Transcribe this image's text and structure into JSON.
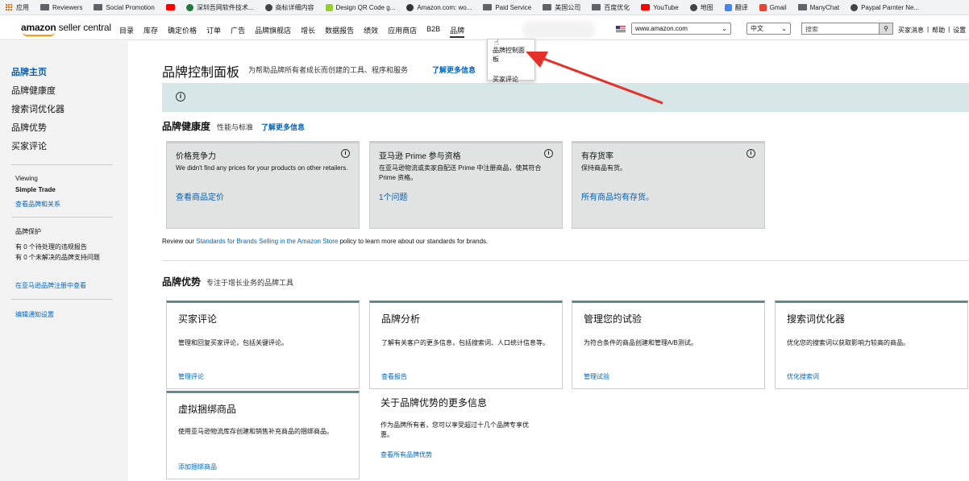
{
  "bookmarks": [
    "应用",
    "Reviewers",
    "Social Promotion",
    "",
    "深圳吾网软件技术...",
    "商标详细内容",
    "Design QR Code g...",
    "Amazon.com: wo...",
    "Paid Service",
    "美国公司",
    "百度优化",
    "YouTube",
    "地图",
    "翻译",
    "Gmail",
    "ManyChat",
    "Paypal Parnter Ne..."
  ],
  "nav": {
    "logo_main": "amazon",
    "logo_sub": " seller central",
    "menu": [
      "目录",
      "库存",
      "确定价格",
      "订单",
      "广告",
      "品牌旗舰店",
      "增长",
      "数据报告",
      "绩效",
      "应用商店",
      "B2B",
      "品牌"
    ],
    "marketplace": "www.amazon.com",
    "language": "中文",
    "search_placeholder": "搜索",
    "links": [
      "买家消息",
      "帮助",
      "设置"
    ]
  },
  "dropdown": [
    "品牌控制面板",
    "买家评论"
  ],
  "sidebar": {
    "nav": [
      "品牌主页",
      "品牌健康度",
      "搜索词优化器",
      "品牌优势",
      "买家评论"
    ],
    "viewing_label": "Viewing",
    "viewing_brand": "Simple Trade",
    "viewing_link": "查看品牌和关系",
    "protection_title": "品牌保护",
    "protection_line1": "有 0 个待处理的违规报告",
    "protection_line2": "有 0 个未解决的品牌支持问题",
    "protection_link": "在亚马逊品牌注册中查看",
    "notify_link": "编辑通知设置"
  },
  "main": {
    "title": "品牌控制面板",
    "subtitle": "为帮助品牌所有者成长而创建的工具、程序和服务",
    "learn_more": "了解更多信息",
    "health": {
      "title": "品牌健康度",
      "subtitle": "性能与标准",
      "learn_more": "了解更多信息",
      "cards": [
        {
          "title": "价格竞争力",
          "desc": "We didn't find any prices for your products on other retailers.",
          "value": "查看商品定价"
        },
        {
          "title": "亚马逊 Prime 参与资格",
          "desc": "在亚马逊物流或卖家自配送 Prime 中注册商品，使其符合 Prime 资格。",
          "value": "1个问题"
        },
        {
          "title": "有存货率",
          "desc": "保持商品有货。",
          "value": "所有商品均有存货。"
        }
      ]
    },
    "review_prefix": "Review our ",
    "review_link": "Standards for Brands Selling in the Amazon Store",
    "review_suffix": " policy to learn more about our standards for brands.",
    "benefits": {
      "title": "品牌优势",
      "subtitle": "专注于增长业务的品牌工具",
      "cards": [
        {
          "title": "买家评论",
          "desc": "管理和回复买家评论，包括关键评论。",
          "link": "管理评论"
        },
        {
          "title": "品牌分析",
          "desc": "了解有关客户的更多信息，包括搜索词、人口统计信息等。",
          "link": "查看报告"
        },
        {
          "title": "管理您的试验",
          "desc": "为符合条件的商品创建和管理A/B测试。",
          "link": "管理试验"
        },
        {
          "title": "搜索词优化器",
          "desc": "优化您的搜索词以获取影响力较高的商品。",
          "link": "优化搜索词"
        },
        {
          "title": "虚拟捆绑商品",
          "desc": "使用亚马逊物流库存创建和销售补充商品的捆绑商品。",
          "link": "添加捆绑商品"
        }
      ],
      "more_title": "关于品牌优势的更多信息",
      "more_desc": "作为品牌所有者，您可以享受超过十几个品牌专享优惠。",
      "more_link": "查看所有品牌优势"
    }
  },
  "colors": {
    "accent_orange": "#ff9900",
    "link": "#0066c0",
    "arrow": "#e8302a",
    "banner": "#d7e7e8",
    "card_border": "#5c8c8c"
  }
}
